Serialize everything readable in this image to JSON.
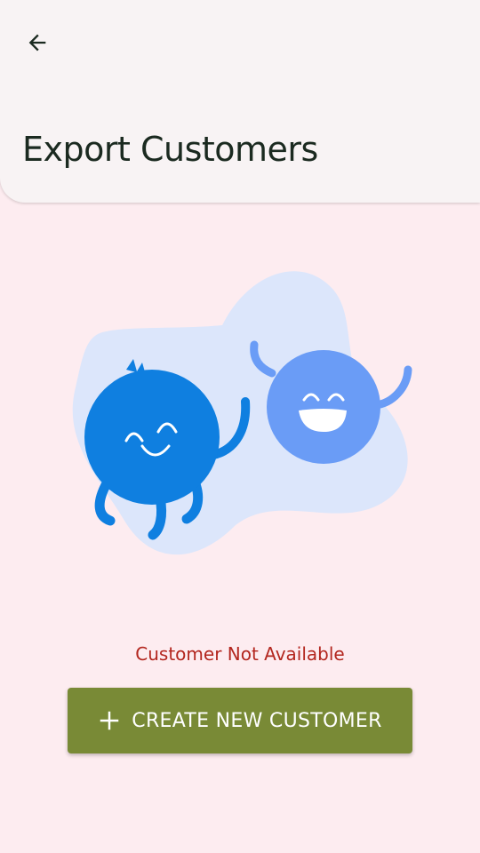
{
  "header": {
    "title": "Export Customers",
    "back_icon": "arrow-left-icon"
  },
  "empty_state": {
    "illustration": "two-happy-characters-illustration",
    "message": "Customer Not Available"
  },
  "create_button": {
    "icon": "plus-icon",
    "label": "CREATE NEW CUSTOMER"
  },
  "colors": {
    "page_background": "#fdecf0",
    "app_bar_background": "#f8f3f4",
    "title_text": "#1b2a20",
    "message_text": "#b3261e",
    "button_background": "#798a36",
    "button_text": "#ffffff",
    "illustration_blob": "#dce6fb",
    "character_dark_blue": "#0f7fe0",
    "character_light_blue": "#6a9cf6"
  }
}
